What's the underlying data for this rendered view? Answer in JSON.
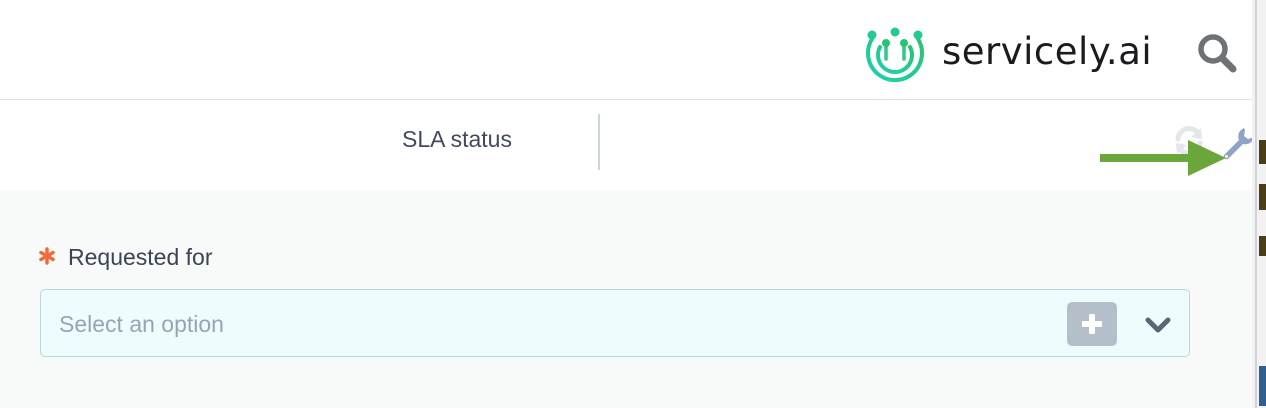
{
  "header": {
    "brand_name": "servicely.ai",
    "logo_icon": "servicely-logo-icon",
    "search_icon": "search-icon",
    "brand_color": "#2ed3a6"
  },
  "tabbar": {
    "sla_tab_label": "SLA status",
    "refresh_icon": "refresh-icon",
    "wrench_icon": "wrench-icon"
  },
  "annotation": {
    "arrow_color": "#6aa63a",
    "points_to": "wrench-icon"
  },
  "form": {
    "requested_for": {
      "label": "Requested for",
      "required": true,
      "required_marker_color": "#f26a3b",
      "placeholder": "Select an option",
      "add_icon": "plus-icon",
      "dropdown_icon": "chevron-down-icon"
    }
  },
  "colors": {
    "field_background": "#effcfd",
    "field_border": "#b9d7e3",
    "form_background": "#f8f9f9",
    "add_button": "#b5bfc9"
  }
}
